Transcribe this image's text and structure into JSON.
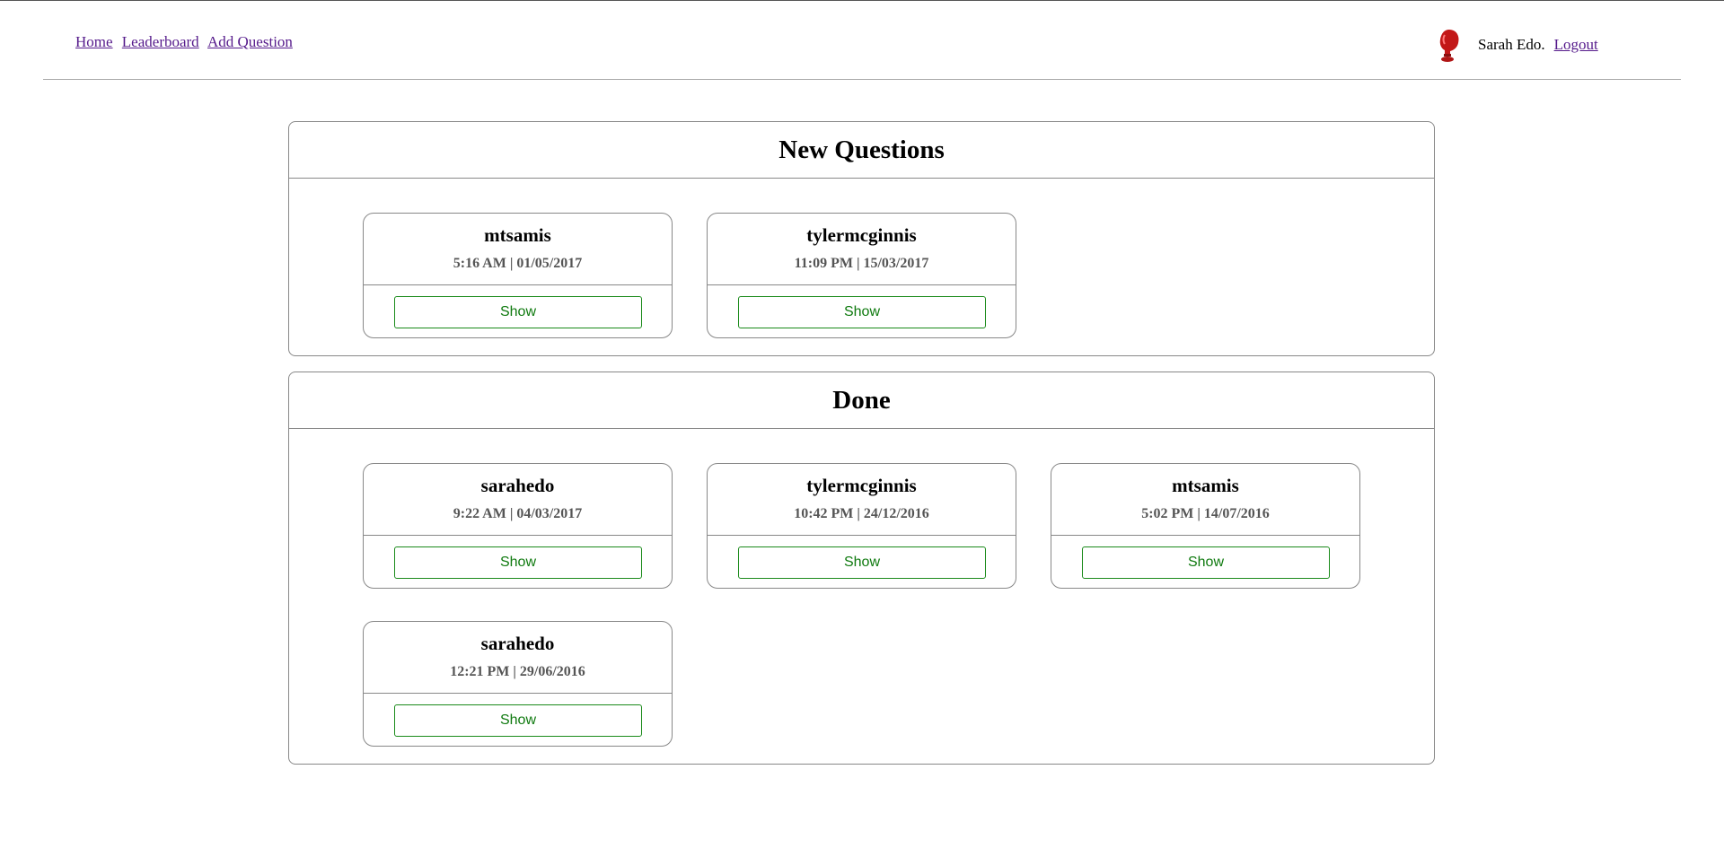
{
  "nav": {
    "home": "Home",
    "leaderboard": "Leaderboard",
    "add_question": "Add Question"
  },
  "user": {
    "name": "Sarah Edo.",
    "logout": "Logout",
    "avatar_icon": "boxing-glove-icon",
    "avatar_color": "#cc1f1f"
  },
  "sections": {
    "new": {
      "title": "New Questions",
      "cards": [
        {
          "author": "mtsamis",
          "time": "5:16 AM | 01/05/2017",
          "button": "Show"
        },
        {
          "author": "tylermcginnis",
          "time": "11:09 PM | 15/03/2017",
          "button": "Show"
        }
      ]
    },
    "done": {
      "title": "Done",
      "cards": [
        {
          "author": "sarahedo",
          "time": "9:22 AM | 04/03/2017",
          "button": "Show"
        },
        {
          "author": "tylermcginnis",
          "time": "10:42 PM | 24/12/2016",
          "button": "Show"
        },
        {
          "author": "mtsamis",
          "time": "5:02 PM | 14/07/2016",
          "button": "Show"
        },
        {
          "author": "sarahedo",
          "time": "12:21 PM | 29/06/2016",
          "button": "Show"
        }
      ]
    }
  },
  "colors": {
    "link": "#551a8b",
    "button_text": "#0f7a0f",
    "button_border": "#1a8a1a"
  }
}
